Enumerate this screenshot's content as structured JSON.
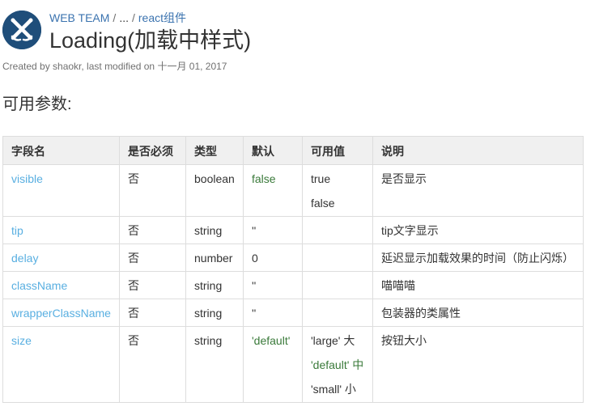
{
  "breadcrumb": {
    "space": "WEB TEAM",
    "separator": "/",
    "ellipsis": "...",
    "parent": "react组件"
  },
  "page": {
    "title": "Loading(加载中样式)",
    "byline": "Created by shaokr, last modified on 十一月 01, 2017",
    "section_heading": "可用参数:"
  },
  "table": {
    "headers": [
      "字段名",
      "是否必须",
      "类型",
      "默认",
      "可用值",
      "说明"
    ],
    "rows": [
      {
        "field": "visible",
        "required": "否",
        "type": "boolean",
        "default": "false",
        "values": [
          "true",
          "false"
        ],
        "desc": "是否显示"
      },
      {
        "field": "tip",
        "required": "否",
        "type": "string",
        "default": "''",
        "values": [],
        "desc": "tip文字显示"
      },
      {
        "field": "delay",
        "required": "否",
        "type": "number",
        "default": "0",
        "values": [],
        "desc": "延迟显示加载效果的时间（防止闪烁）"
      },
      {
        "field": "className",
        "required": "否",
        "type": "string",
        "default": "''",
        "values": [],
        "desc": "喵喵喵"
      },
      {
        "field": "wrapperClassName",
        "required": "否",
        "type": "string",
        "default": "''",
        "values": [],
        "desc": "包装器的类属性"
      },
      {
        "field": "size",
        "required": "否",
        "type": "string",
        "default": "'default'",
        "values": [
          "'large' 大",
          "'default' 中",
          "'small' 小"
        ],
        "desc": "按钮大小"
      }
    ]
  },
  "colors": {
    "link": "#3b73af",
    "field_name": "#59afe1",
    "green_value": "#3a7a3a",
    "logo_bg": "#1f4e7a"
  },
  "icons": {
    "logo": "space-logo-icon"
  }
}
